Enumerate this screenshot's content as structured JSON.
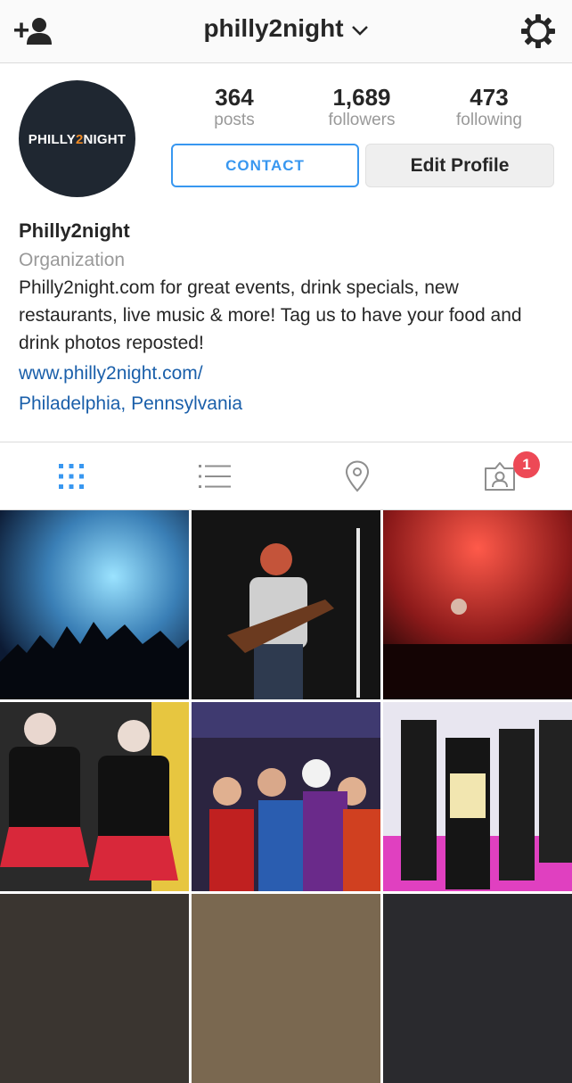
{
  "header": {
    "username": "philly2night",
    "add_user_icon": "add-user-icon",
    "gear_icon": "gear-icon"
  },
  "profile": {
    "avatar_logo_left": "PHILLY",
    "avatar_logo_mid": "2",
    "avatar_logo_right": "NIGHT",
    "stats": [
      {
        "value": "364",
        "label": "posts"
      },
      {
        "value": "1,689",
        "label": "followers"
      },
      {
        "value": "473",
        "label": "following"
      }
    ],
    "contact_label": "CONTACT",
    "edit_label": "Edit Profile",
    "name": "Philly2night",
    "category": "Organization",
    "bio": "Philly2night.com for great events, drink specials, new restaurants, live music & more! Tag us to have your food and drink photos reposted!",
    "website": "www.philly2night.com/",
    "location": "Philadelphia, Pennsylvania"
  },
  "tabs": {
    "items": [
      "grid-icon",
      "list-icon",
      "location-pin-icon",
      "tagged-icon"
    ],
    "tagged_badge": "1"
  },
  "colors": {
    "accent": "#3897f0",
    "link": "#1a5faa",
    "badge": "#ed4956",
    "brand_orange": "#f08a24"
  }
}
